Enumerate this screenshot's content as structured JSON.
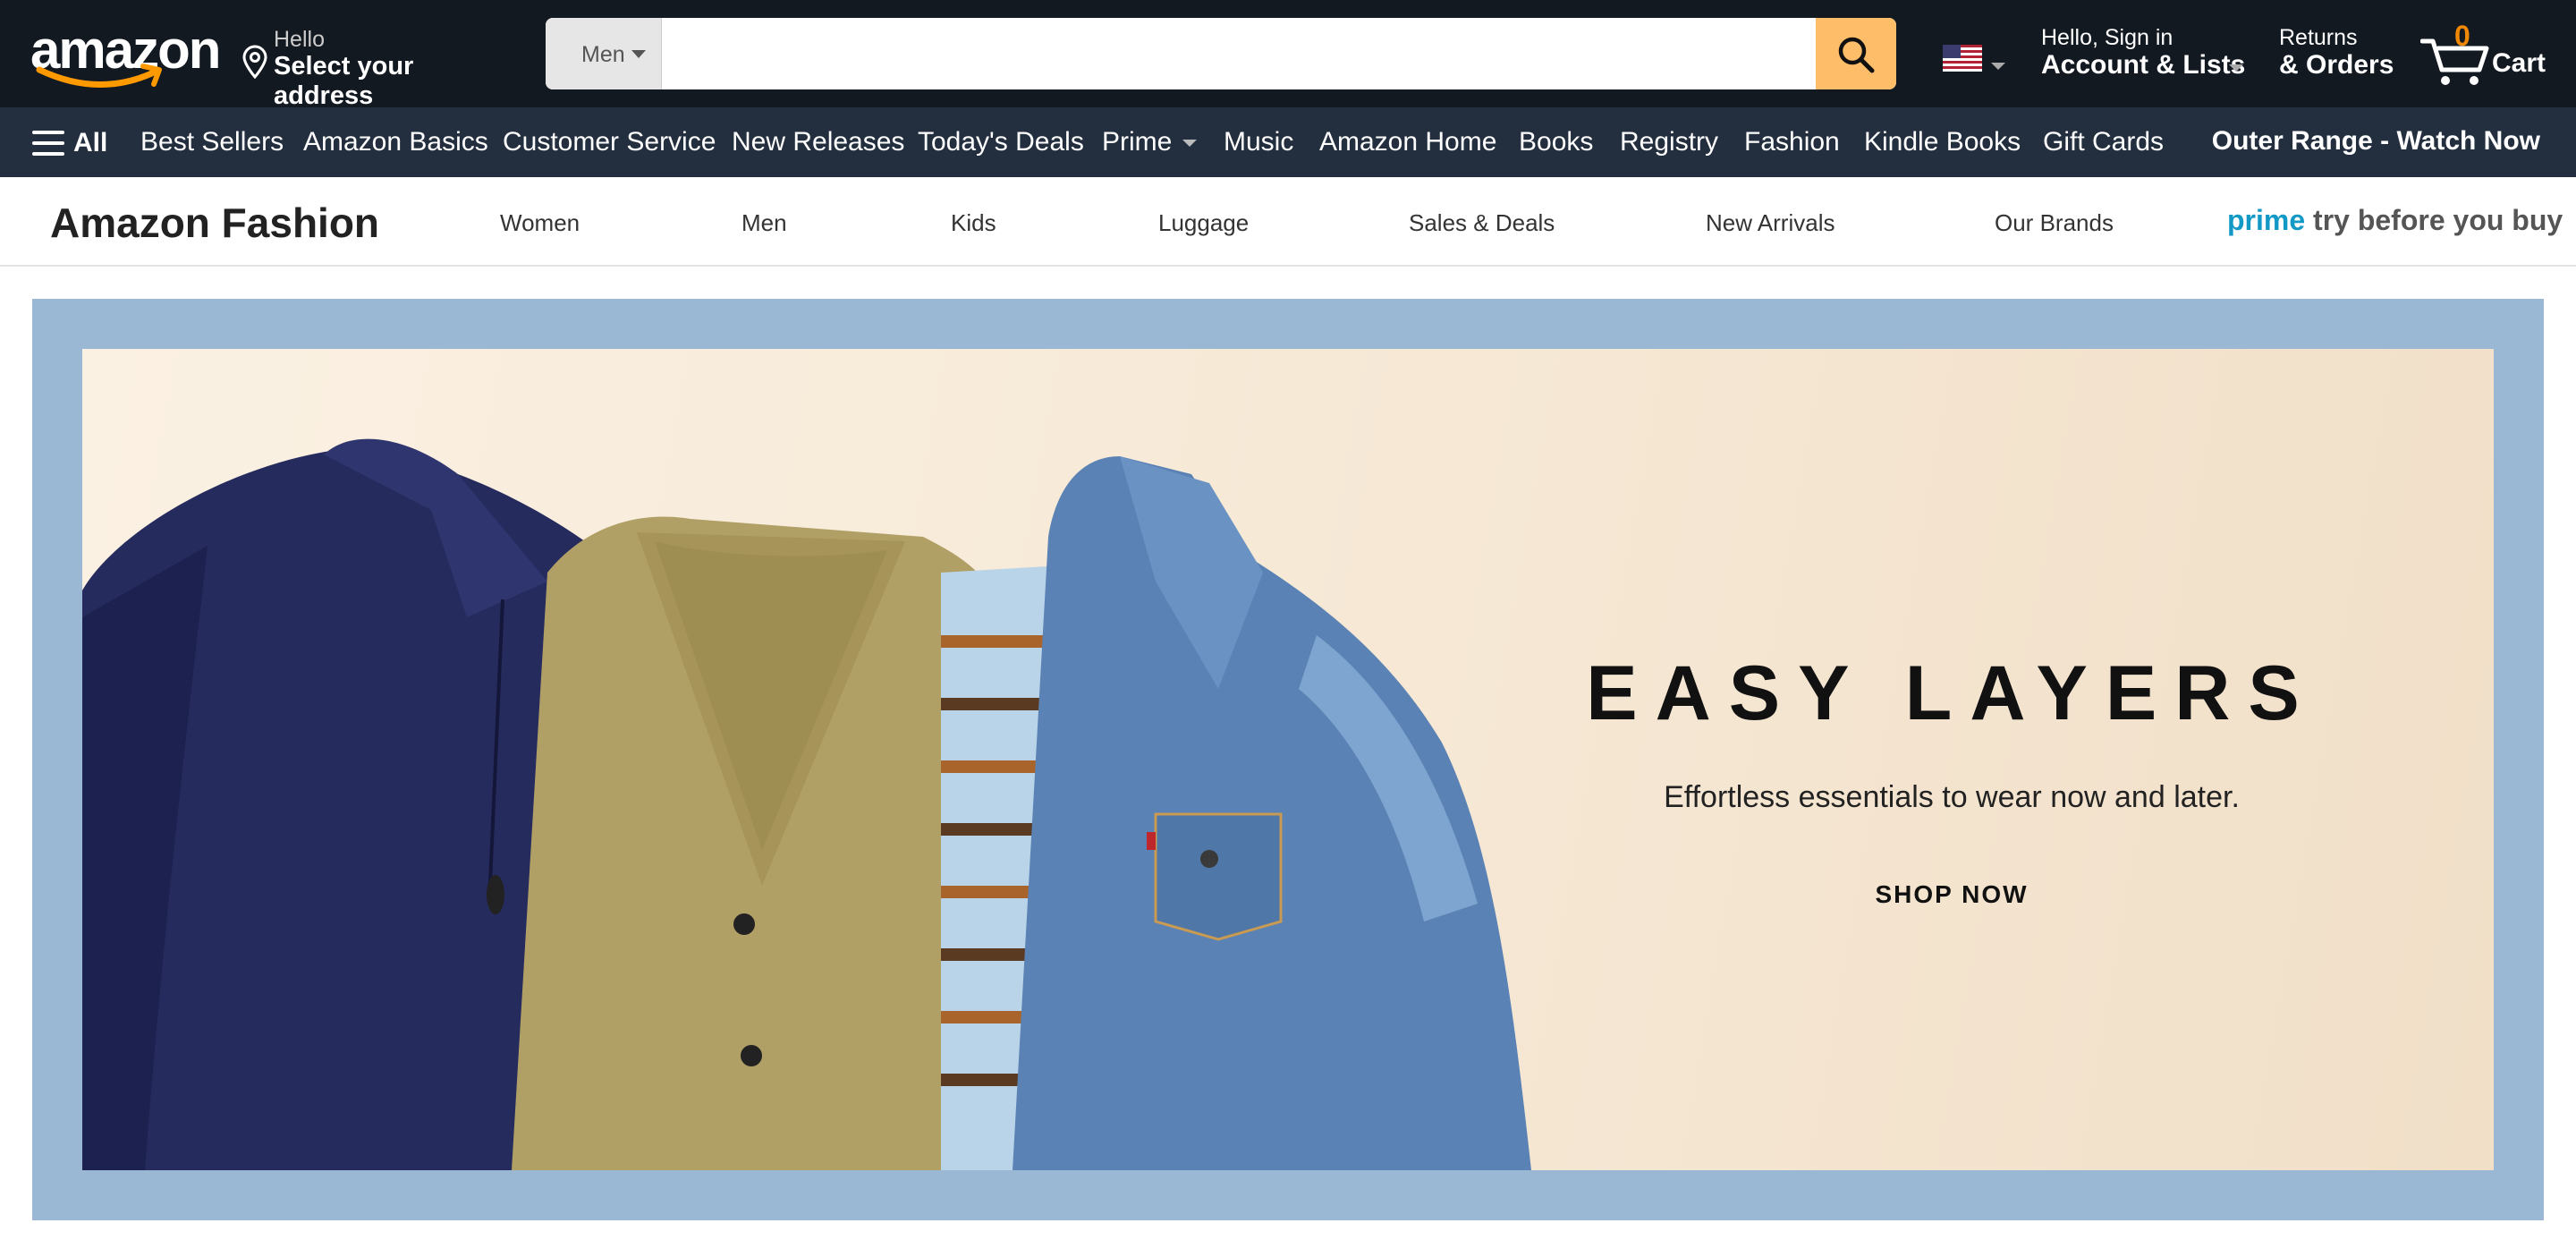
{
  "topbar": {
    "logo_text": "amazon",
    "address_line1": "Hello",
    "address_line2": "Select your address",
    "search_category": "Men",
    "search_placeholder": "",
    "account_line1": "Hello, Sign in",
    "account_line2": "Account & Lists",
    "orders_line1": "Returns",
    "orders_line2": "& Orders",
    "cart_count": "0",
    "cart_label": "Cart",
    "colors": {
      "bg": "#131921",
      "search_button": "#febd69",
      "cart_count": "#f08804"
    },
    "icons": [
      "location-pin-icon",
      "search-icon",
      "us-flag-icon",
      "cart-icon"
    ]
  },
  "subnav": {
    "all_label": "All",
    "items": [
      "Best Sellers",
      "Amazon Basics",
      "Customer Service",
      "New Releases",
      "Today's Deals",
      "Prime",
      "Music",
      "Amazon Home",
      "Books",
      "Registry",
      "Fashion",
      "Kindle Books",
      "Gift Cards"
    ],
    "promo": "Outer Range - Watch Now",
    "colors": {
      "bg": "#232f3e"
    }
  },
  "fashion_bar": {
    "title": "Amazon Fashion",
    "links": [
      "Women",
      "Men",
      "Kids",
      "Luggage",
      "Sales & Deals",
      "New Arrivals",
      "Our Brands"
    ],
    "prime_word": "prime",
    "prime_rest": "try before you buy",
    "colors": {
      "prime": "#1399c6"
    }
  },
  "hero": {
    "headline": "EASY LAYERS",
    "subheadline": "Effortless essentials to wear now and later.",
    "cta": "SHOP NOW",
    "colors": {
      "frame": "#9ab7d4",
      "background": "#f6e8d5"
    }
  }
}
